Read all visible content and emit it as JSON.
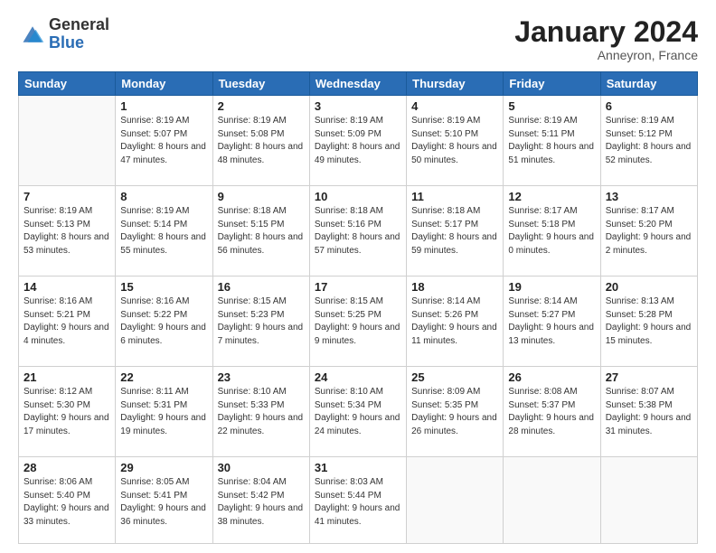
{
  "header": {
    "logo_general": "General",
    "logo_blue": "Blue",
    "month_title": "January 2024",
    "location": "Anneyron, France"
  },
  "weekdays": [
    "Sunday",
    "Monday",
    "Tuesday",
    "Wednesday",
    "Thursday",
    "Friday",
    "Saturday"
  ],
  "weeks": [
    [
      {
        "day": "",
        "sunrise": "",
        "sunset": "",
        "daylight": ""
      },
      {
        "day": "1",
        "sunrise": "Sunrise: 8:19 AM",
        "sunset": "Sunset: 5:07 PM",
        "daylight": "Daylight: 8 hours and 47 minutes."
      },
      {
        "day": "2",
        "sunrise": "Sunrise: 8:19 AM",
        "sunset": "Sunset: 5:08 PM",
        "daylight": "Daylight: 8 hours and 48 minutes."
      },
      {
        "day": "3",
        "sunrise": "Sunrise: 8:19 AM",
        "sunset": "Sunset: 5:09 PM",
        "daylight": "Daylight: 8 hours and 49 minutes."
      },
      {
        "day": "4",
        "sunrise": "Sunrise: 8:19 AM",
        "sunset": "Sunset: 5:10 PM",
        "daylight": "Daylight: 8 hours and 50 minutes."
      },
      {
        "day": "5",
        "sunrise": "Sunrise: 8:19 AM",
        "sunset": "Sunset: 5:11 PM",
        "daylight": "Daylight: 8 hours and 51 minutes."
      },
      {
        "day": "6",
        "sunrise": "Sunrise: 8:19 AM",
        "sunset": "Sunset: 5:12 PM",
        "daylight": "Daylight: 8 hours and 52 minutes."
      }
    ],
    [
      {
        "day": "7",
        "sunrise": "Sunrise: 8:19 AM",
        "sunset": "Sunset: 5:13 PM",
        "daylight": "Daylight: 8 hours and 53 minutes."
      },
      {
        "day": "8",
        "sunrise": "Sunrise: 8:19 AM",
        "sunset": "Sunset: 5:14 PM",
        "daylight": "Daylight: 8 hours and 55 minutes."
      },
      {
        "day": "9",
        "sunrise": "Sunrise: 8:18 AM",
        "sunset": "Sunset: 5:15 PM",
        "daylight": "Daylight: 8 hours and 56 minutes."
      },
      {
        "day": "10",
        "sunrise": "Sunrise: 8:18 AM",
        "sunset": "Sunset: 5:16 PM",
        "daylight": "Daylight: 8 hours and 57 minutes."
      },
      {
        "day": "11",
        "sunrise": "Sunrise: 8:18 AM",
        "sunset": "Sunset: 5:17 PM",
        "daylight": "Daylight: 8 hours and 59 minutes."
      },
      {
        "day": "12",
        "sunrise": "Sunrise: 8:17 AM",
        "sunset": "Sunset: 5:18 PM",
        "daylight": "Daylight: 9 hours and 0 minutes."
      },
      {
        "day": "13",
        "sunrise": "Sunrise: 8:17 AM",
        "sunset": "Sunset: 5:20 PM",
        "daylight": "Daylight: 9 hours and 2 minutes."
      }
    ],
    [
      {
        "day": "14",
        "sunrise": "Sunrise: 8:16 AM",
        "sunset": "Sunset: 5:21 PM",
        "daylight": "Daylight: 9 hours and 4 minutes."
      },
      {
        "day": "15",
        "sunrise": "Sunrise: 8:16 AM",
        "sunset": "Sunset: 5:22 PM",
        "daylight": "Daylight: 9 hours and 6 minutes."
      },
      {
        "day": "16",
        "sunrise": "Sunrise: 8:15 AM",
        "sunset": "Sunset: 5:23 PM",
        "daylight": "Daylight: 9 hours and 7 minutes."
      },
      {
        "day": "17",
        "sunrise": "Sunrise: 8:15 AM",
        "sunset": "Sunset: 5:25 PM",
        "daylight": "Daylight: 9 hours and 9 minutes."
      },
      {
        "day": "18",
        "sunrise": "Sunrise: 8:14 AM",
        "sunset": "Sunset: 5:26 PM",
        "daylight": "Daylight: 9 hours and 11 minutes."
      },
      {
        "day": "19",
        "sunrise": "Sunrise: 8:14 AM",
        "sunset": "Sunset: 5:27 PM",
        "daylight": "Daylight: 9 hours and 13 minutes."
      },
      {
        "day": "20",
        "sunrise": "Sunrise: 8:13 AM",
        "sunset": "Sunset: 5:28 PM",
        "daylight": "Daylight: 9 hours and 15 minutes."
      }
    ],
    [
      {
        "day": "21",
        "sunrise": "Sunrise: 8:12 AM",
        "sunset": "Sunset: 5:30 PM",
        "daylight": "Daylight: 9 hours and 17 minutes."
      },
      {
        "day": "22",
        "sunrise": "Sunrise: 8:11 AM",
        "sunset": "Sunset: 5:31 PM",
        "daylight": "Daylight: 9 hours and 19 minutes."
      },
      {
        "day": "23",
        "sunrise": "Sunrise: 8:10 AM",
        "sunset": "Sunset: 5:33 PM",
        "daylight": "Daylight: 9 hours and 22 minutes."
      },
      {
        "day": "24",
        "sunrise": "Sunrise: 8:10 AM",
        "sunset": "Sunset: 5:34 PM",
        "daylight": "Daylight: 9 hours and 24 minutes."
      },
      {
        "day": "25",
        "sunrise": "Sunrise: 8:09 AM",
        "sunset": "Sunset: 5:35 PM",
        "daylight": "Daylight: 9 hours and 26 minutes."
      },
      {
        "day": "26",
        "sunrise": "Sunrise: 8:08 AM",
        "sunset": "Sunset: 5:37 PM",
        "daylight": "Daylight: 9 hours and 28 minutes."
      },
      {
        "day": "27",
        "sunrise": "Sunrise: 8:07 AM",
        "sunset": "Sunset: 5:38 PM",
        "daylight": "Daylight: 9 hours and 31 minutes."
      }
    ],
    [
      {
        "day": "28",
        "sunrise": "Sunrise: 8:06 AM",
        "sunset": "Sunset: 5:40 PM",
        "daylight": "Daylight: 9 hours and 33 minutes."
      },
      {
        "day": "29",
        "sunrise": "Sunrise: 8:05 AM",
        "sunset": "Sunset: 5:41 PM",
        "daylight": "Daylight: 9 hours and 36 minutes."
      },
      {
        "day": "30",
        "sunrise": "Sunrise: 8:04 AM",
        "sunset": "Sunset: 5:42 PM",
        "daylight": "Daylight: 9 hours and 38 minutes."
      },
      {
        "day": "31",
        "sunrise": "Sunrise: 8:03 AM",
        "sunset": "Sunset: 5:44 PM",
        "daylight": "Daylight: 9 hours and 41 minutes."
      },
      {
        "day": "",
        "sunrise": "",
        "sunset": "",
        "daylight": ""
      },
      {
        "day": "",
        "sunrise": "",
        "sunset": "",
        "daylight": ""
      },
      {
        "day": "",
        "sunrise": "",
        "sunset": "",
        "daylight": ""
      }
    ]
  ]
}
